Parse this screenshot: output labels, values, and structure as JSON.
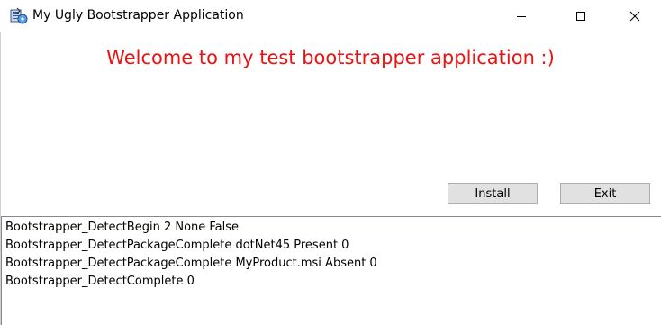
{
  "window": {
    "title": "My Ugly Bootstrapper Application"
  },
  "icons": {
    "app": "installer-app-icon",
    "minimize": "minimize-icon",
    "maximize": "maximize-icon",
    "close": "close-icon"
  },
  "main": {
    "welcome": "Welcome to my test bootstrapper application :)",
    "welcome_color": "#ee1111"
  },
  "actions": {
    "install_label": "Install",
    "exit_label": "Exit"
  },
  "log": {
    "lines": [
      "Bootstrapper_DetectBegin 2 None False",
      "Bootstrapper_DetectPackageComplete dotNet45 Present 0",
      "Bootstrapper_DetectPackageComplete MyProduct.msi Absent 0",
      "Bootstrapper_DetectComplete 0"
    ]
  }
}
